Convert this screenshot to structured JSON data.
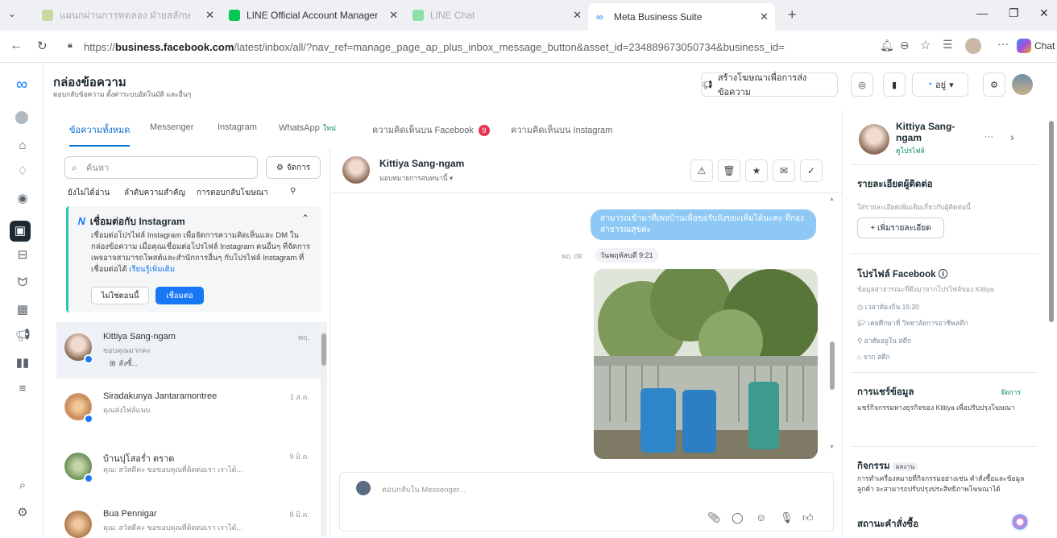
{
  "browser": {
    "tabs": [
      {
        "label": "แผนกผ่านการทดลอง ฝ่ายสลักษ",
        "dim": true
      },
      {
        "label": "LINE Official Account Manager",
        "dim": false
      },
      {
        "label": "LINE Chat",
        "dim": true
      },
      {
        "label": "Meta Business Suite",
        "dim": false
      }
    ],
    "url_prefix": "https://",
    "url_host": "business.facebook.com",
    "url_path": "/latest/inbox/all/?nav_ref=manage_page_ap_plus_inbox_message_button&asset_id=234889673050734&business_id=",
    "chat_label": "Chat"
  },
  "app": {
    "title": "กล่องข้อความ",
    "subtitle": "ตอบกลับข้อความ ตั้งค่าระบบอัตโนมัติ และอื่นๆ",
    "create_ad_label": "สร้างโฆษณาเพื่อการส่งข้อความ",
    "dropdown_label": "อยู่",
    "tabs": [
      {
        "label": "ข้อความทั้งหมด",
        "active": true
      },
      {
        "label": "Messenger"
      },
      {
        "label": "Instagram"
      },
      {
        "label": "WhatsApp",
        "badge": "ใหม่"
      },
      {
        "label": "ความคิดเห็นบน Facebook",
        "count": "9"
      },
      {
        "label": "ความคิดเห็นบน Instagram"
      }
    ]
  },
  "list": {
    "search_placeholder": "ค้นหา",
    "manage_label": "จัดการ",
    "filters": [
      "ยังไม่ได้อ่าน",
      "ลำดับความสำคัญ",
      "การตอบกลับโฆษณา"
    ],
    "ig_card": {
      "title": "เชื่อมต่อกับ Instagram",
      "body": "เชื่อมต่อโปรไฟล์ Instagram เพื่อจัดการความคิดเห็นและ DM ในกล่องข้อความ เมื่อคุณเชื่อมต่อโปรไฟล์ Instagram คนอื่นๆ ที่จัดการเพจอาจสามารถโพสต์และสำนักการอื่นๆ กับโปรไฟล์ Instagram ที่เชื่อมต่อได้",
      "link": "เรียนรู้เพิ่มเติม",
      "not_now": "ไม่ใช่ตอนนี้",
      "connect": "เชื่อมต่อ"
    },
    "conversations": [
      {
        "name": "Kittiya Sang-ngam",
        "preview": "ขอบคุณมากคะ",
        "time": "พฤ.",
        "tag": "สั่งซื้...",
        "selected": true,
        "color": "#d9c7b8"
      },
      {
        "name": "Siradakunya Jantaramontree",
        "preview": "คุณส่งไฟล์แนบ",
        "time": "1 ส.ค.",
        "selected": false,
        "color": "#c98d5a"
      },
      {
        "name": "บ้านปุโสอร่ำ ดราด",
        "preview": "คุณ: สวัสดีคะ ขอขอบคุณที่ติดต่อเรา เราได้...",
        "time": "9 มิ.ค.",
        "selected": false,
        "color": "#9ab37e"
      },
      {
        "name": "Bua Pennigar",
        "preview": "คุณ: สวัสดีคะ ขอขอบคุณที่ติดต่อเรา เราได้...",
        "time": "8 มิ.ค.",
        "selected": false,
        "color": "#d9a77a"
      }
    ]
  },
  "chat": {
    "name": "Kittiya Sang-ngam",
    "assign": "มอบหมายการสนทนานี้",
    "bubble": "สามารถเข้ามาที่เพจบ้านเพื่อขอรับถังขยะเพิ่มได้นะคะ ที่กองสาธารณสุขค่ะ",
    "timestamp": "วันพฤหัสบดี 9:21",
    "ts_prefix": "พฤ. 09:",
    "composer_placeholder": "ตอบกลับใน Messenger..."
  },
  "profile": {
    "name": "Kittiya Sang-ngam",
    "sub": "ดูโปรไฟล์",
    "contact_title": "รายละเอียดผู้ติดต่อ",
    "contact_hint": "ใส่รายละเอียดเพิ่มเติมเกี่ยวกับผู้ติดต่อนี้",
    "add_details": "+ เพิ่มรายละเอียด",
    "fb_title": "โปรไฟล์ Facebook",
    "fb_hint": "ข้อมูลสาธารณะที่ดึงมาจากโปรไฟล์ของ Kittiya",
    "fb_lines": [
      "เวลาท้องถิ่น 15:20",
      "เคยศึกษาที่ วิทยาลัยการอาชีพสตึก",
      "อาศัยอยู่ใน สตึก",
      "จาก สตึก"
    ],
    "share_title": "การแชร์ข้อมูล",
    "share_manage": "จัดการ",
    "share_text": "แชร์กิจกรรมทางธุรกิจของ Kittiya เพื่อปรับปรุงโฆษณา",
    "activity_title": "กิจกรรม",
    "activity_badge": "ผลงาน",
    "activity_text": "การทำเครื่องหมายที่กิจกรรมอย่างเช่น คำสั่งซื้อและข้อมูลลูกค้า จะสามารถปรับปรุงประสิทธิภาพโฆษณาได้",
    "order_title": "สถานะคำสั่งซื้อ"
  }
}
